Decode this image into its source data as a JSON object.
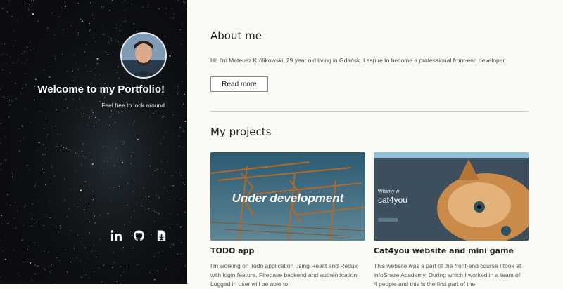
{
  "sidebar": {
    "welcome": "Welcome to my Portfolio!",
    "subtitle": "Feel free to look around",
    "socials": [
      "linkedin-icon",
      "github-icon",
      "download-cv-icon"
    ]
  },
  "about": {
    "heading": "About me",
    "text": "Hi! I'm Mateusz Królikowski, 29 year old living in Gdańsk. I aspire to become a professional front-end developer.",
    "button": "Read more"
  },
  "projects": {
    "heading": "My projects",
    "items": [
      {
        "title": "TODO app",
        "overlay": "Under development",
        "description": "I'm working on Todo application using React and Redux with login feature, Firebase backend and authentication. Logged in user will be able to:"
      },
      {
        "title": "Cat4you website and mini game",
        "description": "This website was a part of the front-end course I took at infoShare Academy. During which I worked in a team of 4 people and this is the first part of the"
      }
    ]
  },
  "colors": {
    "sidebar_bg": "#0b0d10",
    "main_bg": "#fbfbf6"
  }
}
